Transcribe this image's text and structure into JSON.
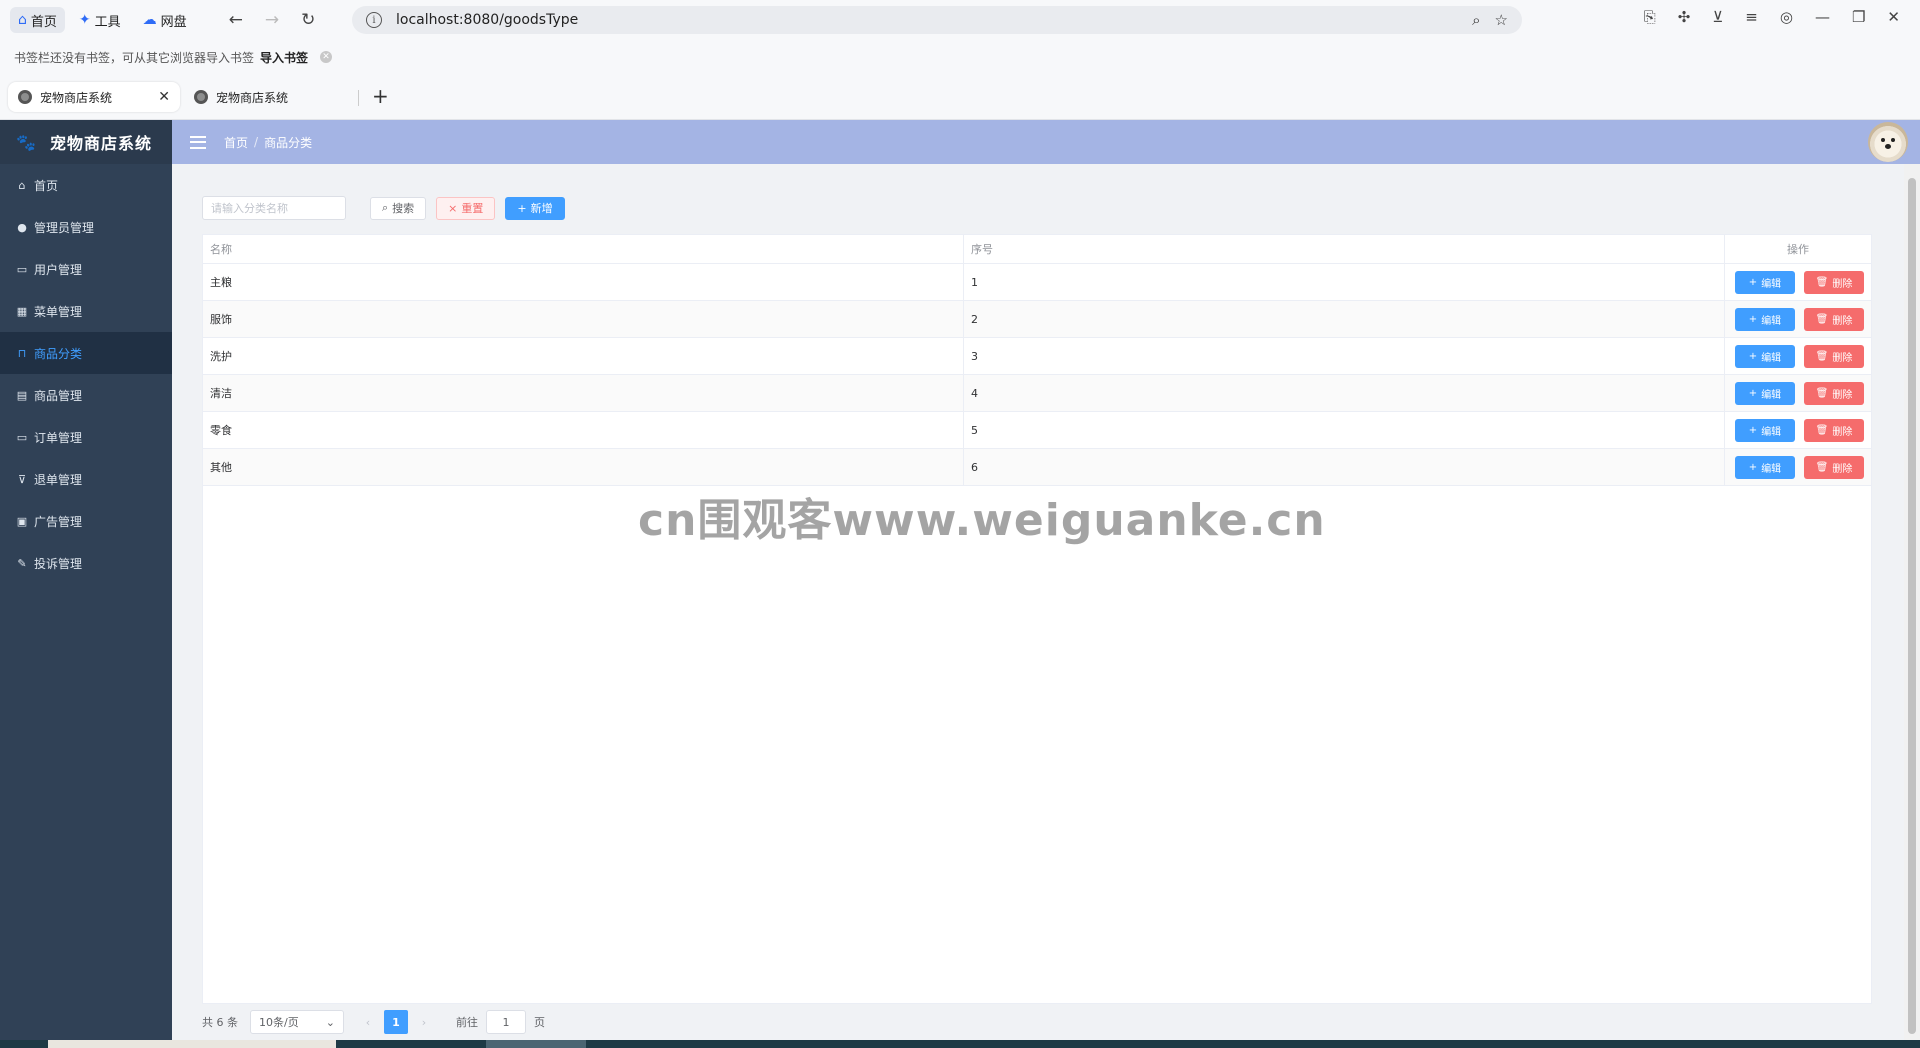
{
  "browser": {
    "quick_tabs": [
      {
        "label": "首页",
        "icon": "home-icon"
      },
      {
        "label": "工具",
        "icon": "tools-icon"
      },
      {
        "label": "网盘",
        "icon": "cloud-icon"
      }
    ],
    "url": "localhost:8080/goodsType",
    "bookmark_hint": "书签栏还没有书签，可从其它浏览器导入书签",
    "bookmark_import": "导入书签",
    "tabs": [
      {
        "title": "宠物商店系统",
        "active": true
      },
      {
        "title": "宠物商店系统",
        "active": false
      }
    ]
  },
  "app": {
    "brand": "宠物商店系统",
    "menu": [
      {
        "label": "首页",
        "icon": "home-icon",
        "active": false
      },
      {
        "label": "管理员管理",
        "icon": "user-icon",
        "active": false
      },
      {
        "label": "用户管理",
        "icon": "folder-icon",
        "active": false
      },
      {
        "label": "菜单管理",
        "icon": "grid-icon",
        "active": false
      },
      {
        "label": "商品分类",
        "icon": "bag-icon",
        "active": true
      },
      {
        "label": "商品管理",
        "icon": "document-icon",
        "active": false
      },
      {
        "label": "订单管理",
        "icon": "monitor-icon",
        "active": false
      },
      {
        "label": "退单管理",
        "icon": "cart-icon",
        "active": false
      },
      {
        "label": "广告管理",
        "icon": "calendar-icon",
        "active": false
      },
      {
        "label": "投诉管理",
        "icon": "edit-icon",
        "active": false
      }
    ],
    "breadcrumb": [
      "首页",
      "商品分类"
    ]
  },
  "toolbar": {
    "search_placeholder": "请输入分类名称",
    "search_label": "搜索",
    "reset_label": "重置",
    "add_label": "新增"
  },
  "table": {
    "headers": {
      "name": "名称",
      "seq": "序号",
      "op": "操作"
    },
    "rows": [
      {
        "name": "主粮",
        "seq": "1"
      },
      {
        "name": "服饰",
        "seq": "2"
      },
      {
        "name": "洗护",
        "seq": "3"
      },
      {
        "name": "清洁",
        "seq": "4"
      },
      {
        "name": "零食",
        "seq": "5"
      },
      {
        "name": "其他",
        "seq": "6"
      }
    ],
    "edit_label": "编辑",
    "delete_label": "删除"
  },
  "pagination": {
    "total": "共 6 条",
    "page_size": "10条/页",
    "current_page": "1",
    "goto_label": "前往",
    "goto_value": "1",
    "page_unit": "页"
  },
  "watermark": "cn围观客www.weiguanke.cn",
  "colors": {
    "sidebar": "#304156",
    "topbar": "#a4b4e4",
    "primary": "#409eff",
    "danger": "#f56c6c"
  }
}
